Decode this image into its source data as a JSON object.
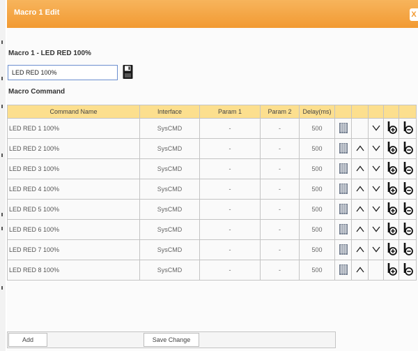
{
  "window": {
    "title": "Macro 1 Edit",
    "close_label": "X"
  },
  "macro": {
    "heading": "Macro 1 - LED RED 100%",
    "name_value": "LED RED 100%",
    "section_label": "Macro Command"
  },
  "table": {
    "headers": [
      "Command Name",
      "Interface",
      "Param 1",
      "Param 2",
      "Delay(ms)"
    ],
    "rows": [
      {
        "name": "LED RED 1 100%",
        "interface": "SysCMD",
        "param1": "-",
        "param2": "-",
        "delay": "500",
        "up": false,
        "down": true
      },
      {
        "name": "LED RED 2 100%",
        "interface": "SysCMD",
        "param1": "-",
        "param2": "-",
        "delay": "500",
        "up": true,
        "down": true
      },
      {
        "name": "LED RED 3 100%",
        "interface": "SysCMD",
        "param1": "-",
        "param2": "-",
        "delay": "500",
        "up": true,
        "down": true
      },
      {
        "name": "LED RED 4 100%",
        "interface": "SysCMD",
        "param1": "-",
        "param2": "-",
        "delay": "500",
        "up": true,
        "down": true
      },
      {
        "name": "LED RED 5 100%",
        "interface": "SysCMD",
        "param1": "-",
        "param2": "-",
        "delay": "500",
        "up": true,
        "down": true
      },
      {
        "name": "LED RED 6 100%",
        "interface": "SysCMD",
        "param1": "-",
        "param2": "-",
        "delay": "500",
        "up": true,
        "down": true
      },
      {
        "name": "LED RED 7 100%",
        "interface": "SysCMD",
        "param1": "-",
        "param2": "-",
        "delay": "500",
        "up": true,
        "down": true
      },
      {
        "name": "LED RED 8 100%",
        "interface": "SysCMD",
        "param1": "-",
        "param2": "-",
        "delay": "500",
        "up": true,
        "down": false
      }
    ]
  },
  "footer": {
    "add_label": "Add",
    "save_change_label": "Save Change"
  },
  "icons": {
    "edit": "grid-edit-icon",
    "up": "arrow-up-icon",
    "down": "arrow-down-icon",
    "insert": "insert-row-icon",
    "remove": "remove-row-icon",
    "save": "floppy-disk-icon"
  },
  "colors": {
    "title_bar": "#f29a32",
    "header_bg": "#fcdf8e",
    "input_border": "#6b8fcf"
  }
}
